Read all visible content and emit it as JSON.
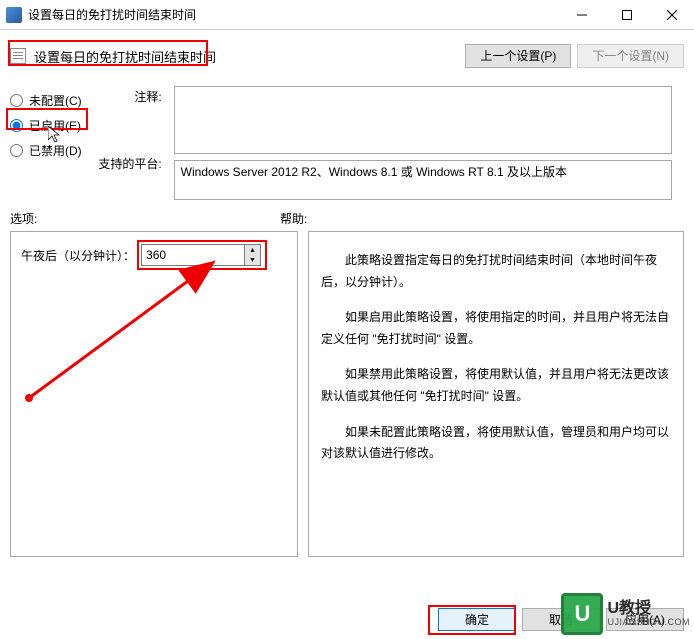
{
  "window": {
    "title": "设置每日的免打扰时间结束时间"
  },
  "header": {
    "policy_title": "设置每日的免打扰时间结束时间",
    "prev_button": "上一个设置(P)",
    "next_button": "下一个设置(N)"
  },
  "radios": {
    "not_configured": "未配置(C)",
    "enabled": "已启用(E)",
    "disabled": "已禁用(D)"
  },
  "labels": {
    "comment": "注释:",
    "platform": "支持的平台:",
    "options": "选项:",
    "help": "帮助:",
    "minutes_after_midnight": "午夜后（以分钟计）："
  },
  "values": {
    "comment_text": "",
    "platform_text": "Windows Server 2012 R2、Windows 8.1 或 Windows RT 8.1 及以上版本",
    "minutes_value": "360"
  },
  "help_text": {
    "p1": "此策略设置指定每日的免打扰时间结束时间（本地时间午夜后，以分钟计）。",
    "p2": "如果启用此策略设置，将使用指定的时间，并且用户将无法自定义任何 \"免打扰时间\" 设置。",
    "p3": "如果禁用此策略设置，将使用默认值，并且用户将无法更改该默认值或其他任何 \"免打扰时间\" 设置。",
    "p4": "如果未配置此策略设置，将使用默认值，管理员和用户均可以对该默认值进行修改。"
  },
  "footer": {
    "ok": "确定",
    "cancel": "取消",
    "apply": "应用(A)"
  },
  "watermark": {
    "brand": "U教授",
    "url": "UJIAOSHOU.COM",
    "logo_letter": "U"
  }
}
